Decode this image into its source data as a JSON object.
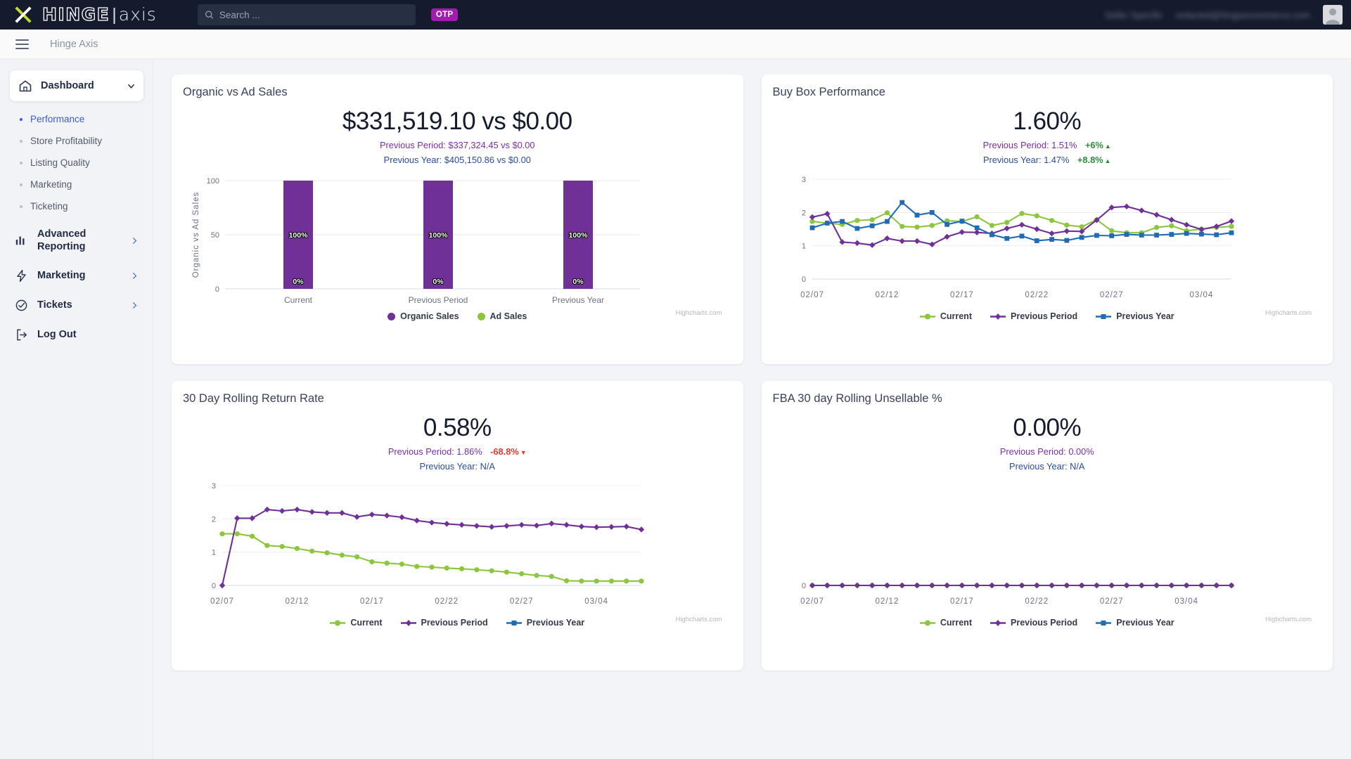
{
  "topbar": {
    "logo_hinge": "HINGE",
    "logo_sep": "|",
    "logo_axis": "axis",
    "search_placeholder": "Search ...",
    "search_value": "",
    "otp_label": "OTP",
    "account_name_redacted": "Seller Specific",
    "account_email_redacted": "redacted@hingeecommerce.com"
  },
  "crumbbar": {
    "breadcrumb": "Hinge Axis"
  },
  "sidebar": {
    "primary": {
      "label": "Dashboard"
    },
    "sub_items": [
      {
        "label": "Performance",
        "active": true
      },
      {
        "label": "Store Profitability",
        "active": false
      },
      {
        "label": "Listing Quality",
        "active": false
      },
      {
        "label": "Marketing",
        "active": false
      },
      {
        "label": "Ticketing",
        "active": false
      }
    ],
    "nav_items": [
      {
        "label": "Advanced Reporting",
        "icon": "bar-chart-icon"
      },
      {
        "label": "Marketing",
        "icon": "bolt-icon"
      },
      {
        "label": "Tickets",
        "icon": "check-circle-icon"
      },
      {
        "label": "Log Out",
        "icon": "logout-icon"
      }
    ]
  },
  "colors": {
    "current_green": "#8cc63f",
    "previous_period_purple": "#6f3098",
    "previous_year_blue": "#1f6cb4",
    "accent_blue": "#3b5bdb",
    "topbar_dark": "#141b2d",
    "otp_magenta": "#a21caf",
    "delta_up_green": "#2e8b3d",
    "delta_down_red": "#e23b2e"
  },
  "credit": "Highcharts.com",
  "cards": [
    {
      "title": "Organic vs Ad Sales",
      "big_value": "$331,519.10 vs $0.00",
      "previous_period": "Previous Period: $337,324.45 vs $0.00",
      "previous_year": "Previous Year: $405,150.86 vs $0.00"
    },
    {
      "title": "Buy Box Performance",
      "big_value": "1.60%",
      "previous_period": "Previous Period: 1.51%",
      "previous_period_delta": "+6%",
      "previous_period_dir": "up",
      "previous_year": "Previous Year: 1.47%",
      "previous_year_delta": "+8.8%",
      "previous_year_dir": "up"
    },
    {
      "title": "30 Day Rolling Return Rate",
      "big_value": "0.58%",
      "previous_period": "Previous Period: 1.86%",
      "previous_period_delta": "-68.8%",
      "previous_period_dir": "down",
      "previous_year": "Previous Year: N/A"
    },
    {
      "title": "FBA 30 day Rolling Unsellable %",
      "big_value": "0.00%",
      "previous_period": "Previous Period: 0.00%",
      "previous_year": "Previous Year: N/A"
    }
  ],
  "chart_data": [
    {
      "type": "bar",
      "title": "Organic vs Ad Sales",
      "ylabel": "Organic vs Ad Sales",
      "xlabel": "",
      "categories": [
        "Current",
        "Previous Period",
        "Previous Year"
      ],
      "ylim": [
        0,
        100
      ],
      "yticks": [
        0,
        50,
        100
      ],
      "grid": true,
      "stacked": true,
      "data_labels": [
        "100%",
        "0%"
      ],
      "legend_position": "bottom",
      "series": [
        {
          "name": "Organic Sales",
          "color": "#6f3098",
          "values": [
            100,
            100,
            100
          ]
        },
        {
          "name": "Ad Sales",
          "color": "#8cc63f",
          "values": [
            0,
            0,
            0
          ]
        }
      ]
    },
    {
      "type": "line",
      "title": "Buy Box Performance",
      "ylabel": "",
      "xlabel": "",
      "ylim": [
        0,
        3
      ],
      "yticks": [
        0,
        1,
        2,
        3
      ],
      "grid": true,
      "legend_position": "bottom",
      "xticks": [
        "02/07",
        "02/12",
        "02/17",
        "02/22",
        "02/27",
        "03/04"
      ],
      "xtick_indices": [
        0,
        5,
        10,
        15,
        20,
        26
      ],
      "series": [
        {
          "name": "Current",
          "color": "#8cc63f",
          "marker": "circle",
          "values": [
            1.73,
            1.68,
            1.64,
            1.76,
            1.78,
            1.99,
            1.58,
            1.56,
            1.61,
            1.75,
            1.73,
            1.87,
            1.61,
            1.7,
            1.97,
            1.9,
            1.76,
            1.62,
            1.57,
            1.78,
            1.45,
            1.39,
            1.39,
            1.55,
            1.6,
            1.45,
            1.5,
            1.55,
            1.58
          ]
        },
        {
          "name": "Previous Period",
          "color": "#6f3098",
          "marker": "diamond",
          "values": [
            1.86,
            1.96,
            1.11,
            1.08,
            1.02,
            1.22,
            1.14,
            1.14,
            1.04,
            1.27,
            1.41,
            1.4,
            1.37,
            1.52,
            1.63,
            1.5,
            1.37,
            1.44,
            1.43,
            1.77,
            2.15,
            2.18,
            2.06,
            1.93,
            1.78,
            1.63,
            1.49,
            1.58,
            1.74
          ]
        },
        {
          "name": "Previous Year",
          "color": "#1f6cb4",
          "marker": "square",
          "values": [
            1.54,
            1.68,
            1.73,
            1.52,
            1.6,
            1.73,
            2.3,
            1.92,
            2.0,
            1.64,
            1.74,
            1.54,
            1.33,
            1.22,
            1.29,
            1.15,
            1.19,
            1.16,
            1.25,
            1.31,
            1.3,
            1.34,
            1.32,
            1.32,
            1.34,
            1.37,
            1.35,
            1.33,
            1.39
          ]
        }
      ]
    },
    {
      "type": "line",
      "title": "30 Day Rolling Return Rate",
      "ylabel": "",
      "xlabel": "",
      "ylim": [
        0,
        3
      ],
      "yticks": [
        0,
        1,
        2,
        3
      ],
      "grid": true,
      "legend_position": "bottom",
      "xticks": [
        "02/07",
        "02/12",
        "02/17",
        "02/22",
        "02/27",
        "03/04"
      ],
      "xtick_indices": [
        0,
        5,
        10,
        15,
        20,
        25
      ],
      "series": [
        {
          "name": "Current",
          "color": "#8cc63f",
          "marker": "circle",
          "values": [
            1.55,
            1.55,
            1.48,
            1.2,
            1.17,
            1.11,
            1.03,
            0.98,
            0.91,
            0.86,
            0.71,
            0.67,
            0.64,
            0.57,
            0.55,
            0.52,
            0.5,
            0.47,
            0.44,
            0.4,
            0.35,
            0.3,
            0.27,
            0.14,
            0.13,
            0.13,
            0.13,
            0.13,
            0.13
          ]
        },
        {
          "name": "Previous Period",
          "color": "#6f3098",
          "marker": "diamond",
          "values": [
            0.0,
            2.02,
            2.02,
            2.28,
            2.24,
            2.28,
            2.21,
            2.18,
            2.18,
            2.06,
            2.13,
            2.1,
            2.05,
            1.95,
            1.89,
            1.85,
            1.82,
            1.79,
            1.76,
            1.79,
            1.82,
            1.8,
            1.86,
            1.82,
            1.77,
            1.75,
            1.76,
            1.77,
            1.68
          ]
        },
        {
          "name": "Previous Year",
          "color": "#1f6cb4",
          "marker": "square",
          "values": []
        }
      ]
    },
    {
      "type": "line",
      "title": "FBA 30 day Rolling Unsellable %",
      "ylabel": "",
      "xlabel": "",
      "ylim": [
        0,
        0
      ],
      "yticks": [
        0
      ],
      "grid": false,
      "legend_position": "bottom",
      "xticks": [
        "02/07",
        "02/12",
        "02/17",
        "02/22",
        "02/27",
        "03/04"
      ],
      "xtick_indices": [
        0,
        5,
        10,
        15,
        20,
        25
      ],
      "series": [
        {
          "name": "Current",
          "color": "#8cc63f",
          "marker": "circle",
          "values": [
            0,
            0,
            0,
            0,
            0,
            0,
            0,
            0,
            0,
            0,
            0,
            0,
            0,
            0,
            0,
            0,
            0,
            0,
            0,
            0,
            0,
            0,
            0,
            0,
            0,
            0,
            0,
            0,
            0
          ]
        },
        {
          "name": "Previous Period",
          "color": "#6f3098",
          "marker": "diamond",
          "values": [
            0,
            0,
            0,
            0,
            0,
            0,
            0,
            0,
            0,
            0,
            0,
            0,
            0,
            0,
            0,
            0,
            0,
            0,
            0,
            0,
            0,
            0,
            0,
            0,
            0,
            0,
            0,
            0,
            0
          ]
        },
        {
          "name": "Previous Year",
          "color": "#1f6cb4",
          "marker": "square",
          "values": []
        }
      ]
    }
  ],
  "legend_labels": {
    "current": "Current",
    "previous_period": "Previous Period",
    "previous_year": "Previous Year"
  }
}
